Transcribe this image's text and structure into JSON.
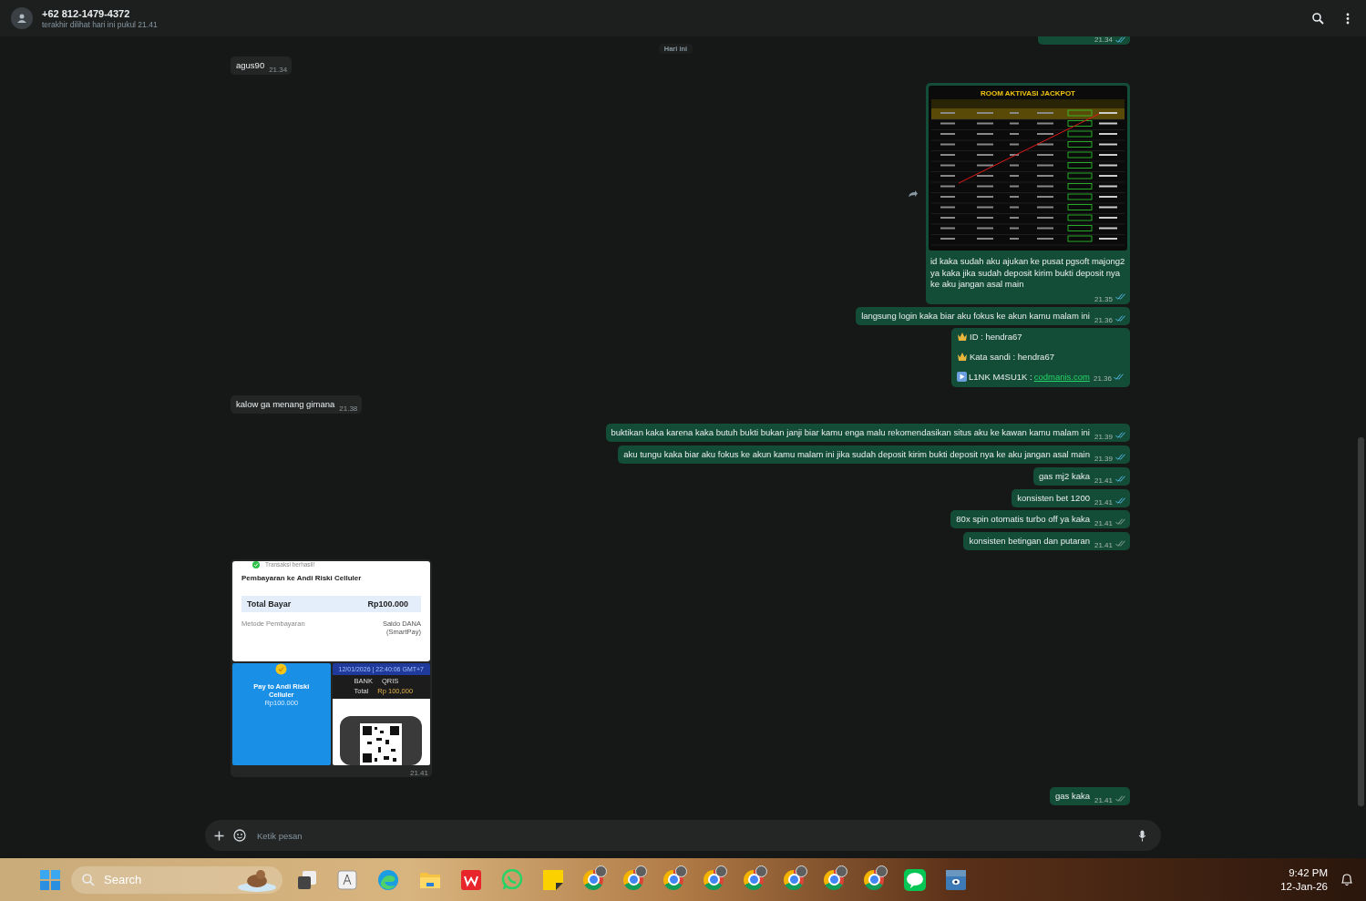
{
  "header": {
    "title": "+62 812-1479-4372",
    "subtitle": "terakhir dilihat hari ini pukul 21.41"
  },
  "messages": [
    {
      "kind": "cut",
      "outgoing": true,
      "time": "21.34",
      "read": true
    },
    {
      "kind": "date",
      "text": "Hari ini"
    },
    {
      "kind": "text",
      "outgoing": false,
      "text": "agus90",
      "time": "21.34"
    },
    {
      "kind": "table_image",
      "outgoing": true,
      "image_title": "ROOM AKTIVASI JACKPOT",
      "text": "id kaka sudah aku ajukan ke pusat pgsoft majong2 ya kaka jika sudah deposit kirim bukti deposit nya ke aku jangan asal main",
      "time": "21.35",
      "read": true
    },
    {
      "kind": "text",
      "outgoing": true,
      "text": "langsung login kaka biar aku fokus ke akun kamu malam ini",
      "time": "21.36",
      "read": true
    },
    {
      "kind": "credentials",
      "outgoing": true,
      "lines": [
        {
          "text": "ID :  hendra67"
        },
        {
          "text": "Kata sandi : hendra67"
        }
      ],
      "link_label": "L1NK M4SU1K : ",
      "link": "codmanis.com",
      "time": "21.36",
      "read": true
    },
    {
      "kind": "text",
      "outgoing": false,
      "text": "kalow ga menang gimana",
      "time": "21.38"
    },
    {
      "kind": "text",
      "outgoing": true,
      "text": "buktikan kaka karena kaka butuh bukti bukan janji biar kamu enga malu rekomendasikan situs aku ke kawan kamu malam ini",
      "time": "21.39",
      "read": true
    },
    {
      "kind": "text",
      "outgoing": true,
      "text": "aku tungu kaka biar aku fokus ke akun kamu malam ini jika sudah deposit kirim bukti deposit nya ke aku jangan asal main",
      "time": "21.39",
      "read": true
    },
    {
      "kind": "text",
      "outgoing": true,
      "text": "gas mj2 kaka",
      "time": "21.41",
      "read": true
    },
    {
      "kind": "text",
      "outgoing": true,
      "text": "konsisten bet 1200",
      "time": "21.41",
      "read": true
    },
    {
      "kind": "text",
      "outgoing": true,
      "text": "80x spin otomatis turbo off ya kaka",
      "time": "21.41",
      "read": false
    },
    {
      "kind": "text",
      "outgoing": true,
      "text": "konsisten betingan dan putaran",
      "time": "21.41",
      "read": false
    },
    {
      "kind": "receipts",
      "outgoing": false,
      "status": "Transaksi berhasil!",
      "payee": "Pembayaran ke Andi Riski Celluler",
      "total_label": "Total Bayar",
      "total": "Rp100.000",
      "method_label": "Metode Pembayaran",
      "method": "Saldo DANA (SmartPay)",
      "pay_title": "Pay to Andi Riski Celluler",
      "pay_amount": "Rp100.000",
      "qris_date": "12/01/2026 | 22:40:06 GMT+7",
      "qris_bank": "BANK",
      "qris_name": "QRIS",
      "qris_total_label": "Total",
      "qris_total": "Rp 100,000",
      "time": "21.41"
    },
    {
      "kind": "text",
      "outgoing": true,
      "text": "gas kaka",
      "time": "21.41",
      "read": false
    }
  ],
  "composer": {
    "placeholder": "Ketik pesan"
  },
  "taskbar": {
    "search": "Search",
    "time": "9:42 PM",
    "date": "12-Jan-26"
  }
}
